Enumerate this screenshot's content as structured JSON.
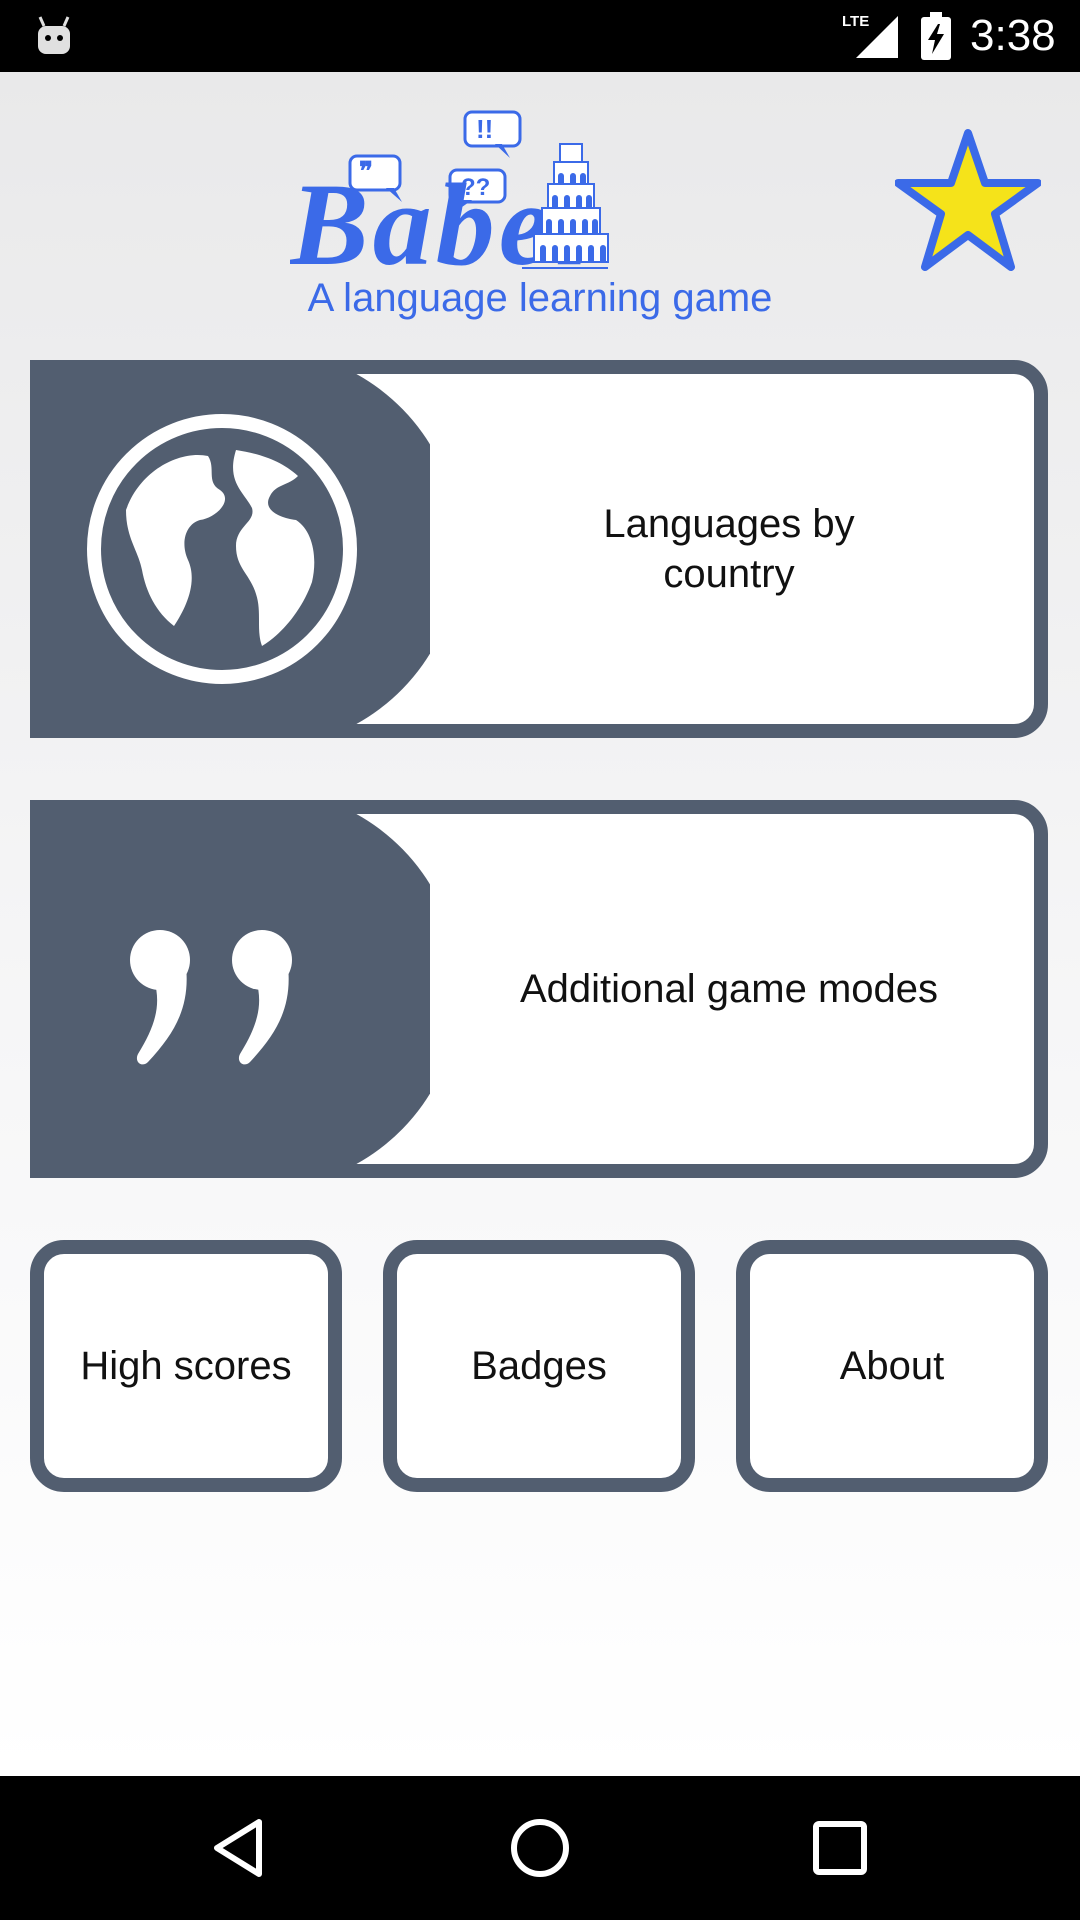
{
  "status_bar": {
    "time": "3:38",
    "network": "LTE",
    "icons": [
      "android-icon",
      "lte-signal-icon",
      "battery-charging-icon"
    ]
  },
  "header": {
    "logo_text": "Babel",
    "logo_bubbles": [
      "!!",
      "??"
    ],
    "tagline": "A language learning game",
    "star_icon": "star-icon"
  },
  "main_menu": {
    "languages_by_country": {
      "label": "Languages by\ncountry",
      "icon": "globe-icon"
    },
    "additional_game_modes": {
      "label": "Additional game modes",
      "icon": "quote-icon"
    }
  },
  "secondary_menu": {
    "high_scores": "High scores",
    "badges": "Badges",
    "about": "About"
  },
  "nav_bar": {
    "icons": [
      "back-icon",
      "home-icon",
      "recents-icon"
    ]
  },
  "colors": {
    "accent_blue": "#3b6ae8",
    "card_slate": "#525e70",
    "star_yellow": "#f5e31a"
  }
}
